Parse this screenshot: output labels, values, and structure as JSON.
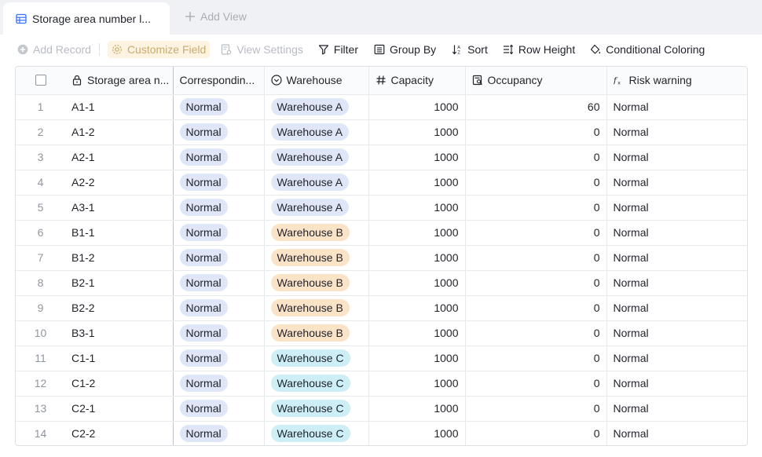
{
  "tabs": {
    "active_label": "Storage area number l...",
    "add_view_label": "Add View"
  },
  "toolbar": {
    "add_record": "Add Record",
    "customize_field": "Customize Field",
    "view_settings": "View Settings",
    "filter": "Filter",
    "group_by": "Group By",
    "sort": "Sort",
    "row_height": "Row Height",
    "conditional_coloring": "Conditional Coloring"
  },
  "columns": {
    "name": "Storage area n...",
    "corresponding": "Correspondin...",
    "warehouse": "Warehouse",
    "capacity": "Capacity",
    "occupancy": "Occupancy",
    "risk": "Risk warning"
  },
  "colors": {
    "pill_normal": "#dfe6f7",
    "warehouse_a": "#dfe6f7",
    "warehouse_b": "#fbe3c8",
    "warehouse_c": "#cdeef7"
  },
  "rows": [
    {
      "idx": "1",
      "name": "A1-1",
      "corr": "Normal",
      "wh": "Warehouse A",
      "cap": "1000",
      "occ": "60",
      "risk": "Normal"
    },
    {
      "idx": "2",
      "name": "A1-2",
      "corr": "Normal",
      "wh": "Warehouse A",
      "cap": "1000",
      "occ": "0",
      "risk": "Normal"
    },
    {
      "idx": "3",
      "name": "A2-1",
      "corr": "Normal",
      "wh": "Warehouse A",
      "cap": "1000",
      "occ": "0",
      "risk": "Normal"
    },
    {
      "idx": "4",
      "name": "A2-2",
      "corr": "Normal",
      "wh": "Warehouse A",
      "cap": "1000",
      "occ": "0",
      "risk": "Normal"
    },
    {
      "idx": "5",
      "name": "A3-1",
      "corr": "Normal",
      "wh": "Warehouse A",
      "cap": "1000",
      "occ": "0",
      "risk": "Normal"
    },
    {
      "idx": "6",
      "name": "B1-1",
      "corr": "Normal",
      "wh": "Warehouse B",
      "cap": "1000",
      "occ": "0",
      "risk": "Normal"
    },
    {
      "idx": "7",
      "name": "B1-2",
      "corr": "Normal",
      "wh": "Warehouse B",
      "cap": "1000",
      "occ": "0",
      "risk": "Normal"
    },
    {
      "idx": "8",
      "name": "B2-1",
      "corr": "Normal",
      "wh": "Warehouse B",
      "cap": "1000",
      "occ": "0",
      "risk": "Normal"
    },
    {
      "idx": "9",
      "name": "B2-2",
      "corr": "Normal",
      "wh": "Warehouse B",
      "cap": "1000",
      "occ": "0",
      "risk": "Normal"
    },
    {
      "idx": "10",
      "name": "B3-1",
      "corr": "Normal",
      "wh": "Warehouse B",
      "cap": "1000",
      "occ": "0",
      "risk": "Normal"
    },
    {
      "idx": "11",
      "name": "C1-1",
      "corr": "Normal",
      "wh": "Warehouse C",
      "cap": "1000",
      "occ": "0",
      "risk": "Normal"
    },
    {
      "idx": "12",
      "name": "C1-2",
      "corr": "Normal",
      "wh": "Warehouse C",
      "cap": "1000",
      "occ": "0",
      "risk": "Normal"
    },
    {
      "idx": "13",
      "name": "C2-1",
      "corr": "Normal",
      "wh": "Warehouse C",
      "cap": "1000",
      "occ": "0",
      "risk": "Normal"
    },
    {
      "idx": "14",
      "name": "C2-2",
      "corr": "Normal",
      "wh": "Warehouse C",
      "cap": "1000",
      "occ": "0",
      "risk": "Normal"
    }
  ]
}
